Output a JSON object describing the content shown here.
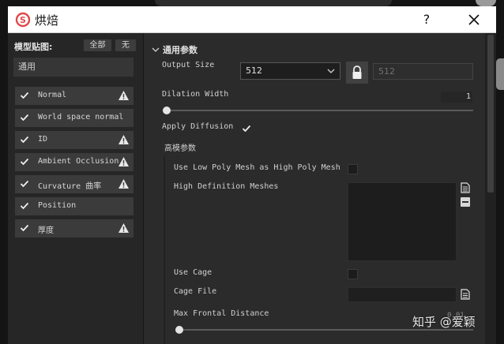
{
  "window": {
    "title": "烘焙",
    "help_label": "?"
  },
  "left_panel": {
    "header": "模型贴图:",
    "select_all_label": "全部",
    "select_none_label": "无",
    "filter_value": "通用",
    "items": [
      {
        "label": "Normal",
        "checked": true,
        "warning": true
      },
      {
        "label": "World space normal",
        "checked": true,
        "warning": false
      },
      {
        "label": "ID",
        "checked": true,
        "warning": true
      },
      {
        "label": "Ambient Occlusion",
        "checked": true,
        "warning": true
      },
      {
        "label": "Curvature 曲率",
        "checked": true,
        "warning": true
      },
      {
        "label": "Position",
        "checked": true,
        "warning": false
      },
      {
        "label": "厚度",
        "checked": true,
        "warning": true
      }
    ]
  },
  "common_params": {
    "section_title": "通用参数",
    "output_size_label": "Output Size",
    "output_size_value": "512",
    "linked_size_value": "512",
    "dilation_width_label": "Dilation Width",
    "dilation_width_value": "1",
    "dilation_width_fraction": 0.0,
    "apply_diffusion_label": "Apply Diffusion",
    "apply_diffusion_checked": true
  },
  "high_poly_params": {
    "section_title": "高模参数",
    "use_low_poly_label": "Use Low Poly Mesh as High Poly Mesh",
    "use_low_poly_checked": false,
    "high_def_meshes_label": "High Definition Meshes",
    "use_cage_label": "Use Cage",
    "use_cage_checked": false,
    "cage_file_label": "Cage File",
    "cage_file_value": "",
    "max_frontal_label": "Max Frontal Distance",
    "max_frontal_value": "0.01",
    "max_frontal_fraction": 0.0
  },
  "icons": {
    "app": "substance-logo-icon",
    "lock": "lock-icon",
    "warning": "warning-icon",
    "file": "file-icon",
    "minus": "minus-icon",
    "close": "close-icon",
    "collapse": "chevron-down-icon"
  },
  "colors": {
    "accent": "#e04a4a",
    "panel_bg": "#2b2b2b",
    "left_bg": "#262626"
  },
  "watermark": "知乎 @爱颖"
}
